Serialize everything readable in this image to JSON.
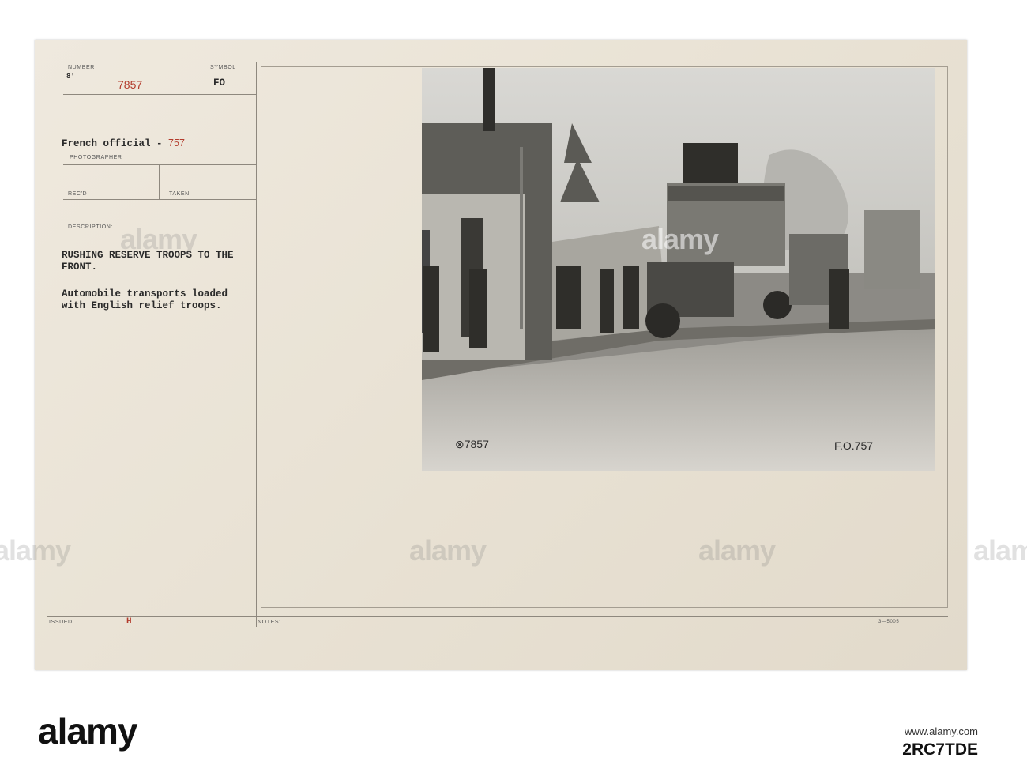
{
  "card": {
    "labels": {
      "number": "NUMBER",
      "symbol": "SYMBOL",
      "photographer": "PHOTOGRAPHER",
      "recd": "REC'D",
      "taken": "TAKEN",
      "description": "DESCRIPTION:",
      "issued": "ISSUED:",
      "notes": "NOTES:"
    },
    "number_prefix": "8'",
    "number_value": "7857",
    "symbol_value": "FO",
    "photographer_value": "French official",
    "photographer_number": "757",
    "desc_title_1": "RUSHING RESERVE TROOPS TO THE",
    "desc_title_2": "FRONT.",
    "desc_body_1": "Automobile transports loaded",
    "desc_body_2": "with English relief troops.",
    "issued_value": "H",
    "form_code": "3—5005"
  },
  "photo": {
    "ink_left": "⊗7857",
    "ink_right": "F.O.757"
  },
  "watermark": {
    "text": "alamy"
  },
  "footer": {
    "logo": "alamy",
    "site": "www.alamy.com",
    "image_id": "2RC7TDE"
  }
}
